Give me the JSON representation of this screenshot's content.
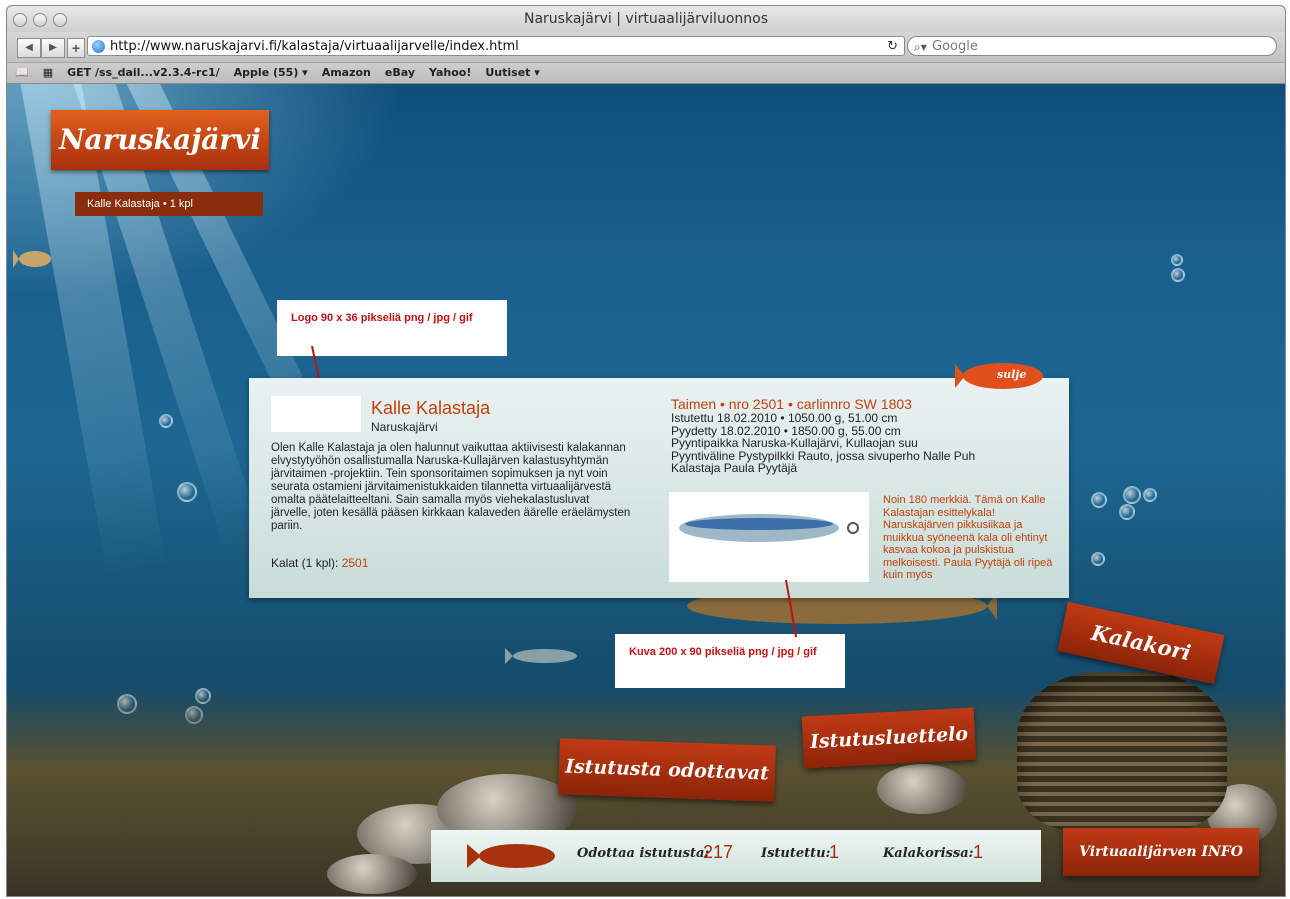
{
  "browser": {
    "title": "Naruskajärvi | virtuaalijärviluonnos",
    "url": "http://www.naruskajarvi.fi/kalastaja/virtuaalijarvelle/index.html",
    "search_placeholder": "Google",
    "bookmarks": [
      "GET /ss_dail...v2.3.4-rc1/",
      "Apple (55) ▾",
      "Amazon",
      "eBay",
      "Yahoo!",
      "Uutiset ▾"
    ]
  },
  "page": {
    "logo_text": "Naruskajärvi",
    "user_bar": "Kalle Kalastaja • 1 kpl",
    "notes": {
      "logo": "Logo 90 x 36 pikseliä png / jpg / gif",
      "image": "Kuva 200 x 90 pikseliä png / jpg / gif"
    },
    "card": {
      "name": "Kalle Kalastaja",
      "lake": "Naruskajärvi",
      "bio": "Olen Kalle Kalastaja ja olen halunnut vaikuttaa aktiivisesti kalakannan elvystytyöhön osallistumalla Naruska-Kullajärven kalastusyhtymän järvitaimen -projektiin. Tein sponsoritaimen sopimuksen ja nyt voin seurata ostamieni järvitaimenistukkaiden tilannetta virtuaalijärvestä omalta päätelaitteeltani. Sain samalla myös viehekalastusluvat järvelle, joten kesällä pääsen kirkkaan kalaveden äärelle eräelämysten pariin.",
      "fish_count_label": "Kalat (1 kpl):",
      "fish_count_link": "2501",
      "fish_title": "Taimen • nro 2501 • carlinnro SW 1803",
      "fish_lines": [
        "Istutettu 18.02.2010 • 1050.00 g, 51.00 cm",
        "Pyydetty 18.02.2010 • 1850.00 g, 55.00 cm",
        "Pyyntipaikka Naruska-Kullajärvi, Kullaojan suu",
        "Pyyntiväline Pystypilkki Rauto, jossa sivuperho Nalle Puh",
        "Kalastaja Paula Pyytäjä"
      ],
      "lure_caption": "Noin 180 merkkiä. Tämä on Kalle Kalastajan esittelykala! Naruskajärven pikkusiikaa ja muikkua syöneenä kala oli ehtinyt kasvaa kokoa ja pulskistua melkoisesti. Paula Pyytäjä oli ripeä kuin myös",
      "close_label": "sulje"
    },
    "banners": {
      "waiting": "Istutusta odottavat",
      "list": "Istutusluettelo",
      "basket": "Kalakori",
      "info": "Virtuaalijärven INFO"
    },
    "status": {
      "waiting_label": "Odottaa istutusta:",
      "waiting_value": "217",
      "stocked_label": "Istutettu:",
      "stocked_value": "1",
      "basket_label": "Kalakorissa:",
      "basket_value": "1"
    }
  },
  "colors": {
    "accent": "#c2410c",
    "banner": "#a52d0c",
    "water": "#1a5f8d"
  }
}
